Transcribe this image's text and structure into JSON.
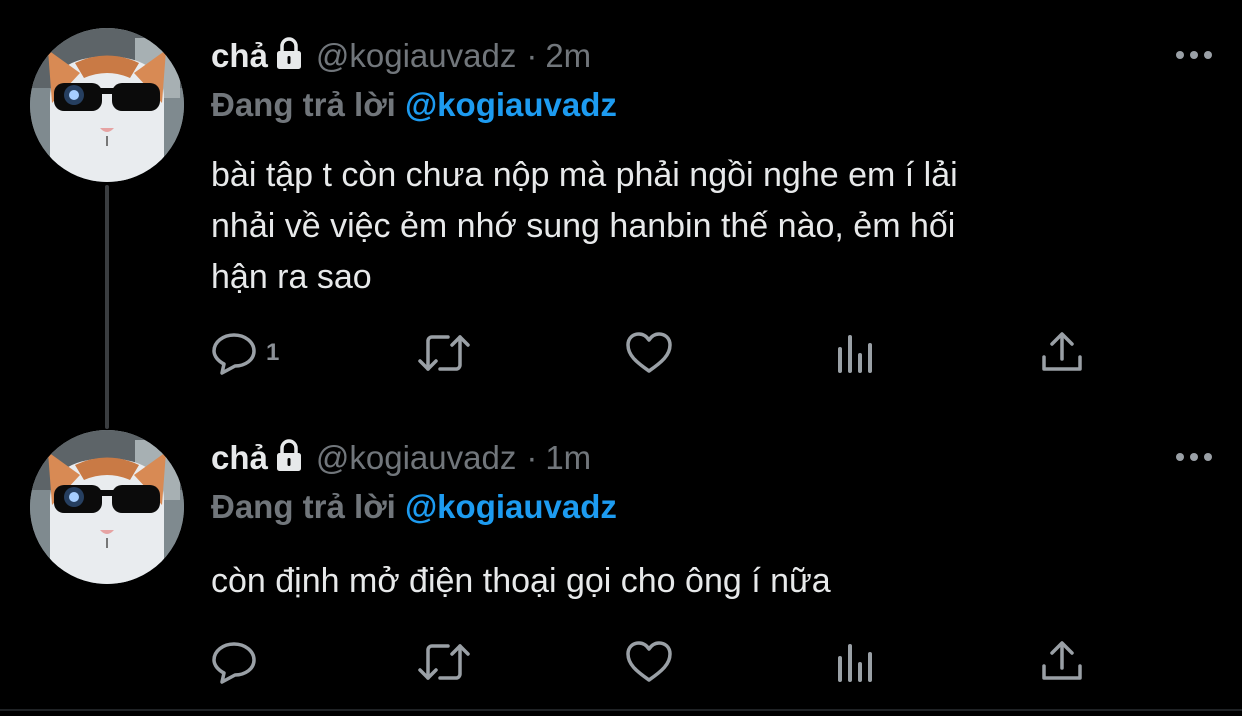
{
  "colors": {
    "background": "#000000",
    "text": "#e7e9ea",
    "muted": "#71767b",
    "mention": "#1d9bf0"
  },
  "tweets": [
    {
      "name": "chả",
      "handle": "@kogiauvadz",
      "dot": "·",
      "time": "2m",
      "replying_prefix": "Đang trả lời ",
      "replying_to": "@kogiauvadz",
      "lines": [
        "bài tập t còn chưa nộp mà phải ngồi nghe em í lải",
        "nhải về việc ẻm nhớ sung hanbin thế nào, ẻm hối",
        "hận ra sao"
      ],
      "reply_count": "1"
    },
    {
      "name": "chả",
      "handle": "@kogiauvadz",
      "dot": "·",
      "time": "1m",
      "replying_prefix": "Đang trả lời ",
      "replying_to": "@kogiauvadz",
      "lines": [
        "còn định mở điện thoại gọi cho ông í nữa"
      ],
      "reply_count": ""
    }
  ],
  "icons": [
    "more-icon",
    "lock-icon",
    "reply-icon",
    "retweet-icon",
    "like-icon",
    "views-icon",
    "share-icon"
  ]
}
